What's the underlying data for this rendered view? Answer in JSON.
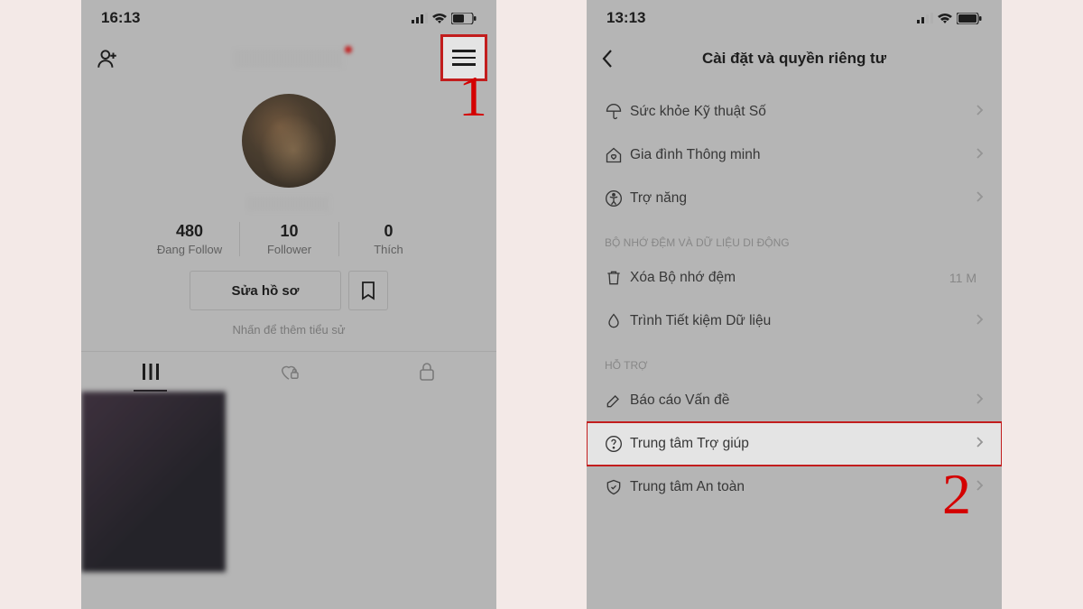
{
  "step_labels": {
    "one": "1",
    "two": "2"
  },
  "phone1": {
    "time": "16:13",
    "stats": {
      "following_count": "480",
      "following_label": "Đang Follow",
      "followers_count": "10",
      "followers_label": "Follower",
      "likes_count": "0",
      "likes_label": "Thích"
    },
    "edit_profile_label": "Sửa hồ sơ",
    "bio_hint": "Nhấn để thêm tiểu sử"
  },
  "phone2": {
    "time": "13:13",
    "title": "Cài đặt và quyền riêng tư",
    "rows_top": [
      {
        "label": "Sức khỏe Kỹ thuật Số"
      },
      {
        "label": "Gia đình Thông minh"
      },
      {
        "label": "Trợ năng"
      }
    ],
    "section_cache": "BỘ NHỚ ĐỆM VÀ DỮ LIỆU DI ĐỘNG",
    "rows_cache": [
      {
        "label": "Xóa Bộ nhớ đệm",
        "side": "11 M"
      },
      {
        "label": "Trình Tiết kiệm Dữ liệu"
      }
    ],
    "section_support": "HỖ TRỢ",
    "rows_support": [
      {
        "label": "Báo cáo Vấn đề"
      },
      {
        "label": "Trung tâm Trợ giúp"
      },
      {
        "label": "Trung tâm An toàn"
      }
    ]
  }
}
